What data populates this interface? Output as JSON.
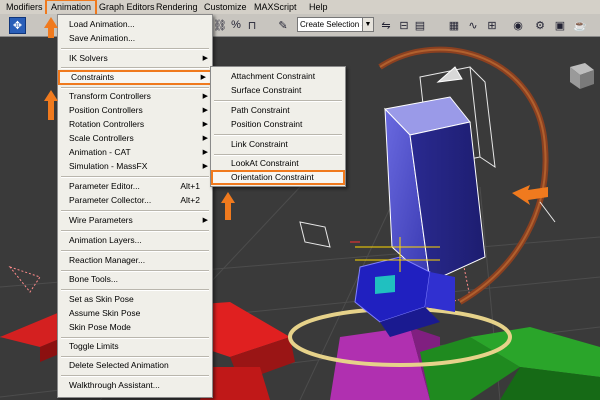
{
  "menubar": {
    "items": [
      "Modifiers",
      "Animation",
      "Graph Editors",
      "Rendering",
      "Customize",
      "MAXScript",
      "Help"
    ],
    "active": "Animation"
  },
  "toolbar": {
    "selection_set": "Create Selection Se"
  },
  "animation_menu": {
    "items": [
      {
        "label": "Load Animation..."
      },
      {
        "label": "Save Animation..."
      },
      {
        "label": "IK Solvers",
        "submenu": true
      },
      {
        "label": "Constraints",
        "submenu": true,
        "highlighted": true
      },
      {
        "label": "Transform Controllers",
        "submenu": true
      },
      {
        "label": "Position Controllers",
        "submenu": true
      },
      {
        "label": "Rotation Controllers",
        "submenu": true
      },
      {
        "label": "Scale Controllers",
        "submenu": true
      },
      {
        "label": "Animation - CAT",
        "submenu": true
      },
      {
        "label": "Simulation - MassFX",
        "submenu": true
      },
      {
        "label": "Parameter Editor...",
        "shortcut": "Alt+1"
      },
      {
        "label": "Parameter Collector...",
        "shortcut": "Alt+2"
      },
      {
        "label": "Wire Parameters",
        "submenu": true
      },
      {
        "label": "Animation Layers..."
      },
      {
        "label": "Reaction Manager..."
      },
      {
        "label": "Bone Tools..."
      },
      {
        "label": "Set as Skin Pose"
      },
      {
        "label": "Assume Skin Pose"
      },
      {
        "label": "Skin Pose Mode"
      },
      {
        "label": "Toggle Limits"
      },
      {
        "label": "Delete Selected Animation"
      },
      {
        "label": "Walkthrough Assistant..."
      }
    ]
  },
  "constraints_menu": {
    "items": [
      {
        "label": "Attachment Constraint"
      },
      {
        "label": "Surface Constraint"
      },
      {
        "label": "Path Constraint"
      },
      {
        "label": "Position Constraint"
      },
      {
        "label": "Link Constraint"
      },
      {
        "label": "LookAt Constraint"
      },
      {
        "label": "Orientation Constraint",
        "highlighted": true
      }
    ]
  },
  "colors": {
    "accent": "#f07a1e",
    "viewport": "#3a3a3a",
    "menu_bg": "#f0efe9",
    "selection_blue": "#2a5fb8"
  },
  "icons": {
    "toolbar": [
      "select-move-icon",
      "link-icon",
      "unlink-icon",
      "percent-snap-icon",
      "spinner-snap-icon",
      "named-sets-icon",
      "mirror-icon",
      "align-icon",
      "layer-icon",
      "curve-editor-icon",
      "schematic-icon",
      "material-editor-icon",
      "render-setup-icon",
      "render-frame-icon",
      "render-icon"
    ],
    "viewport": "viewcube-icon"
  }
}
